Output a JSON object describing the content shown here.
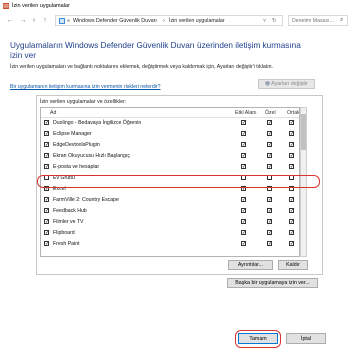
{
  "window": {
    "title": "İzin verilen uygulamalar"
  },
  "address": {
    "crumbs": [
      "«",
      "Windows Defender Güvenlik Duvarı",
      "›",
      "İzin verilen uygulamalar"
    ]
  },
  "search": {
    "placeholder": "Denetim Masası..."
  },
  "heading": "Uygulamaların Windows Defender Güvenlik Duvarı üzerinden iletişim kurmasına izin ver",
  "description": "İzin verilen uygulamaları ve bağlantı noktalarını eklemek, değiştirmek veya kaldırmak için, Ayarları değiştir'i tıklatın.",
  "risk_link": "Bir uygulamanın iletişim kurmasına izin vermenin riskleri nelerdir?",
  "change_settings": "Ayarları değiştir",
  "group": {
    "label": "İzin verilen uygulamalar ve özellikler:",
    "columns": {
      "name": "Ad",
      "domain": "Etki Alanı",
      "private": "Özel",
      "public": "Ortak"
    },
    "rows": [
      {
        "name": "Duolingo - Bedavaya İngilizce Öğrenin",
        "enabled": true,
        "domain": true,
        "private": true,
        "public": true
      },
      {
        "name": "Eclipse Manager",
        "enabled": true,
        "domain": true,
        "private": true,
        "public": true
      },
      {
        "name": "EdgeDevtoolsPlugin",
        "enabled": true,
        "domain": true,
        "private": true,
        "public": true
      },
      {
        "name": "Ekran Okuyucusu Hızlı Başlangıç",
        "enabled": true,
        "domain": true,
        "private": true,
        "public": true
      },
      {
        "name": "E-posta ve hesaplar",
        "enabled": true,
        "domain": true,
        "private": true,
        "public": true
      },
      {
        "name": "Ev Grubu",
        "enabled": false,
        "domain": false,
        "private": false,
        "public": false
      },
      {
        "name": "Excel",
        "enabled": true,
        "domain": true,
        "private": false,
        "public": false
      },
      {
        "name": "FarmVille 2: Country Escape",
        "enabled": true,
        "domain": true,
        "private": true,
        "public": true
      },
      {
        "name": "Feedback Hub",
        "enabled": true,
        "domain": true,
        "private": true,
        "public": true
      },
      {
        "name": "Filmler ve TV",
        "enabled": true,
        "domain": true,
        "private": true,
        "public": true
      },
      {
        "name": "Flipboard",
        "enabled": true,
        "domain": true,
        "private": true,
        "public": true
      },
      {
        "name": "Fresh Paint",
        "enabled": true,
        "domain": true,
        "private": true,
        "public": true
      }
    ],
    "details_button": "Ayrıntılar...",
    "remove_button": "Kaldır"
  },
  "allow_another_button": "Başka bir uygulamaya izin ver...",
  "ok_button": "Tamam",
  "cancel_button": "İptal",
  "colors": {
    "heading": "#1e3f8a",
    "link": "#0b57a8",
    "highlight": "#d9332f"
  }
}
